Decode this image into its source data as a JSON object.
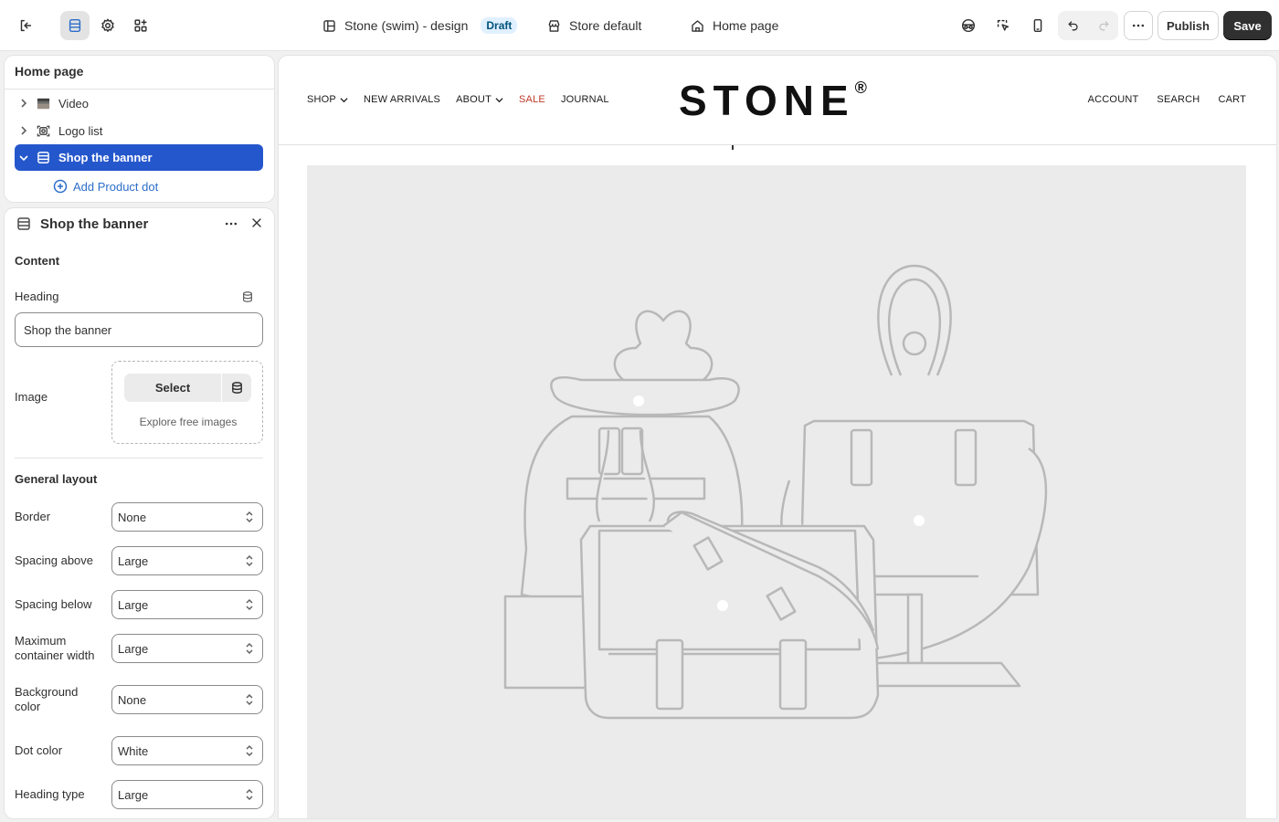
{
  "topbar": {
    "theme_name": "Stone (swim) - design",
    "theme_status": "Draft",
    "store_context": "Store default",
    "page_selector": "Home page",
    "publish_label": "Publish",
    "save_label": "Save"
  },
  "tree": {
    "title": "Home page",
    "items": [
      {
        "label": "Video",
        "icon": "video-thumbnail-icon",
        "expanded": false,
        "selected": false
      },
      {
        "label": "Logo list",
        "icon": "logo-list-icon",
        "expanded": false,
        "selected": false
      },
      {
        "label": "Shop the banner",
        "icon": "section-icon",
        "expanded": true,
        "selected": true
      }
    ],
    "add_block_label": "Add Product dot"
  },
  "settings": {
    "title": "Shop the banner",
    "content_section": "Content",
    "heading_label": "Heading",
    "heading_value": "Shop the banner",
    "image_label": "Image",
    "image_select_label": "Select",
    "image_explore_label": "Explore free images",
    "layout_section": "General layout",
    "fields": [
      {
        "label": "Border",
        "value": "None"
      },
      {
        "label": "Spacing above",
        "value": "Large"
      },
      {
        "label": "Spacing below",
        "value": "Large"
      },
      {
        "label": "Maximum container width",
        "value": "Large"
      },
      {
        "label": "Background color",
        "value": "None"
      },
      {
        "label": "Dot color",
        "value": "White"
      },
      {
        "label": "Heading type",
        "value": "Large"
      }
    ]
  },
  "preview": {
    "nav_left": [
      "SHOP",
      "NEW ARRIVALS",
      "ABOUT",
      "SALE",
      "JOURNAL"
    ],
    "logo": "STONE",
    "logo_mark": "®",
    "nav_right": [
      "ACCOUNT",
      "SEARCH",
      "CART"
    ]
  },
  "colors": {
    "accent": "#2557cc",
    "sale": "#c0392b",
    "save_button": "#303030",
    "banner_bg": "#ebebeb"
  }
}
